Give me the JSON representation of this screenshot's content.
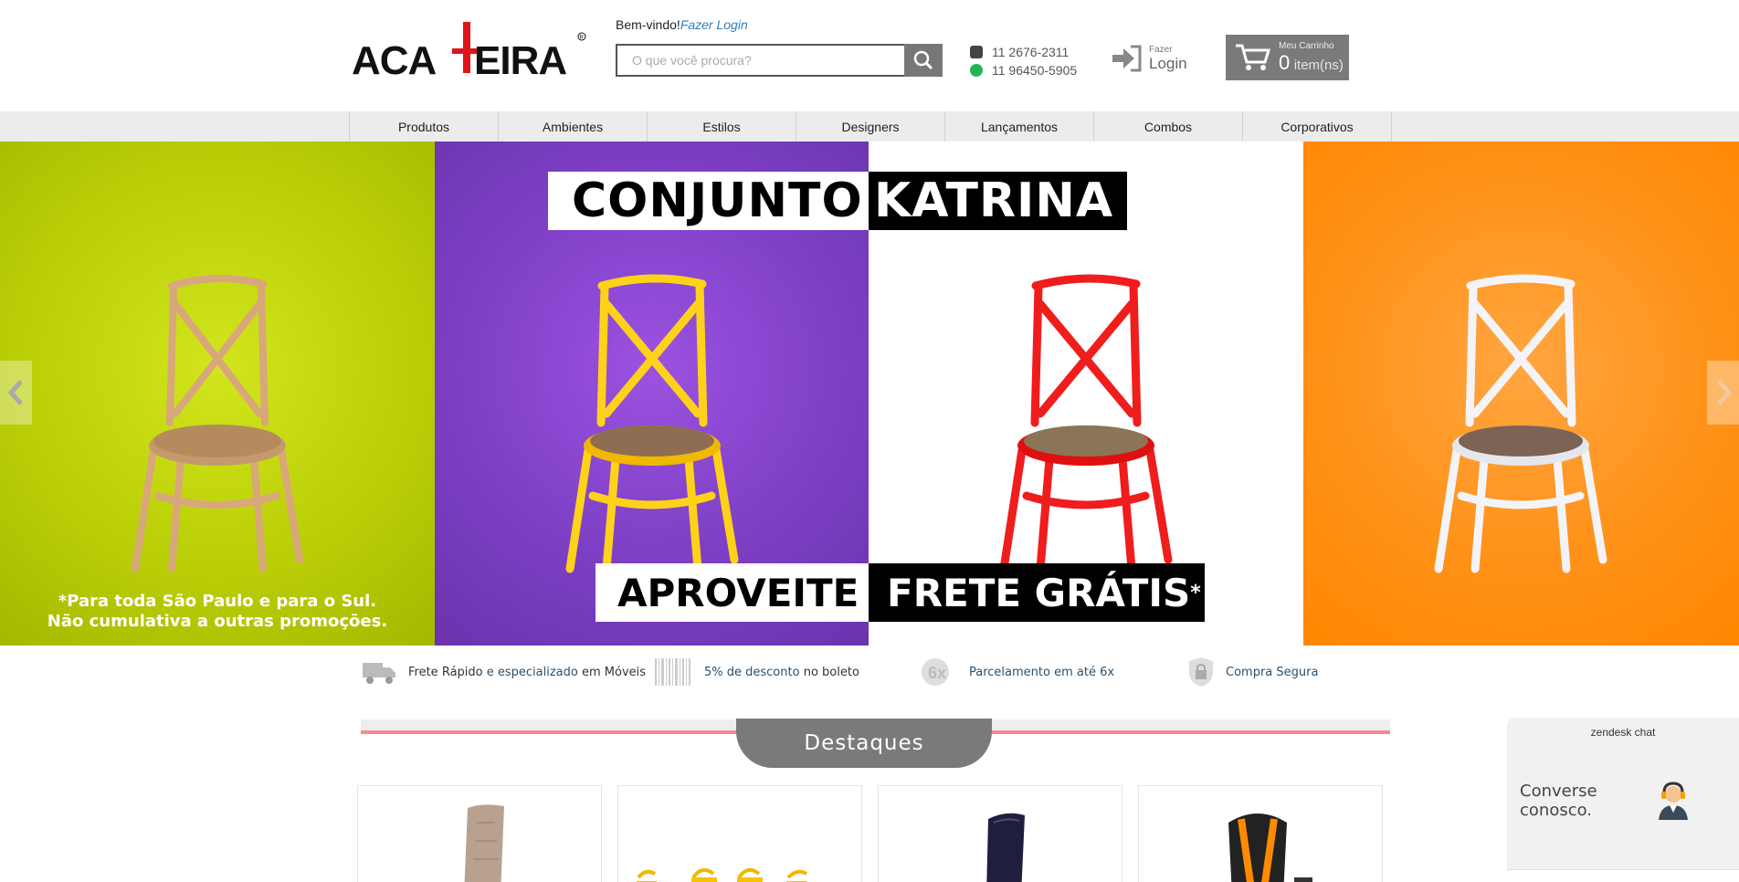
{
  "header": {
    "logo_text": "ACADEIRA",
    "welcome_text": "Bem-vindo!",
    "login_link": "Fazer Login",
    "search_placeholder": "O que você procura?",
    "phone": "11 2676-2311",
    "whatsapp": "11 96450-5905",
    "login_small": "Fazer",
    "login_big": "Login",
    "cart_label": "Meu Carrinho",
    "cart_count": "0",
    "cart_unit": "item(ns)"
  },
  "nav": [
    "Produtos",
    "Ambientes",
    "Estilos",
    "Designers",
    "Lançamentos",
    "Combos",
    "Corporativos"
  ],
  "banner": {
    "title_left": "CONJUNTO",
    "title_right": "KATRINA",
    "sub_left": "APROVEITE",
    "sub_right": "FRETE GRÁTIS",
    "sub_right_mark": "*",
    "note_line1": "*Para toda São Paulo e para o Sul.",
    "note_line2": "Não cumulativa a outras promoções.",
    "colors": {
      "green": "#b8cd06",
      "purple": "#7d3fc5",
      "white": "#ffffff",
      "orange": "#ff9218"
    }
  },
  "benefits": {
    "b1_a": "Frete Rápido",
    "b1_b": "e especializado",
    "b1_c": "em Móveis",
    "b2_a": "5% de desconto",
    "b2_b": "no boleto",
    "b3": "Parcelamento em até 6x",
    "b4": "Compra Segura"
  },
  "destaques": {
    "title": "Destaques"
  },
  "chat": {
    "brand": "zendesk chat",
    "line1": "Converse",
    "line2": "conosco."
  }
}
